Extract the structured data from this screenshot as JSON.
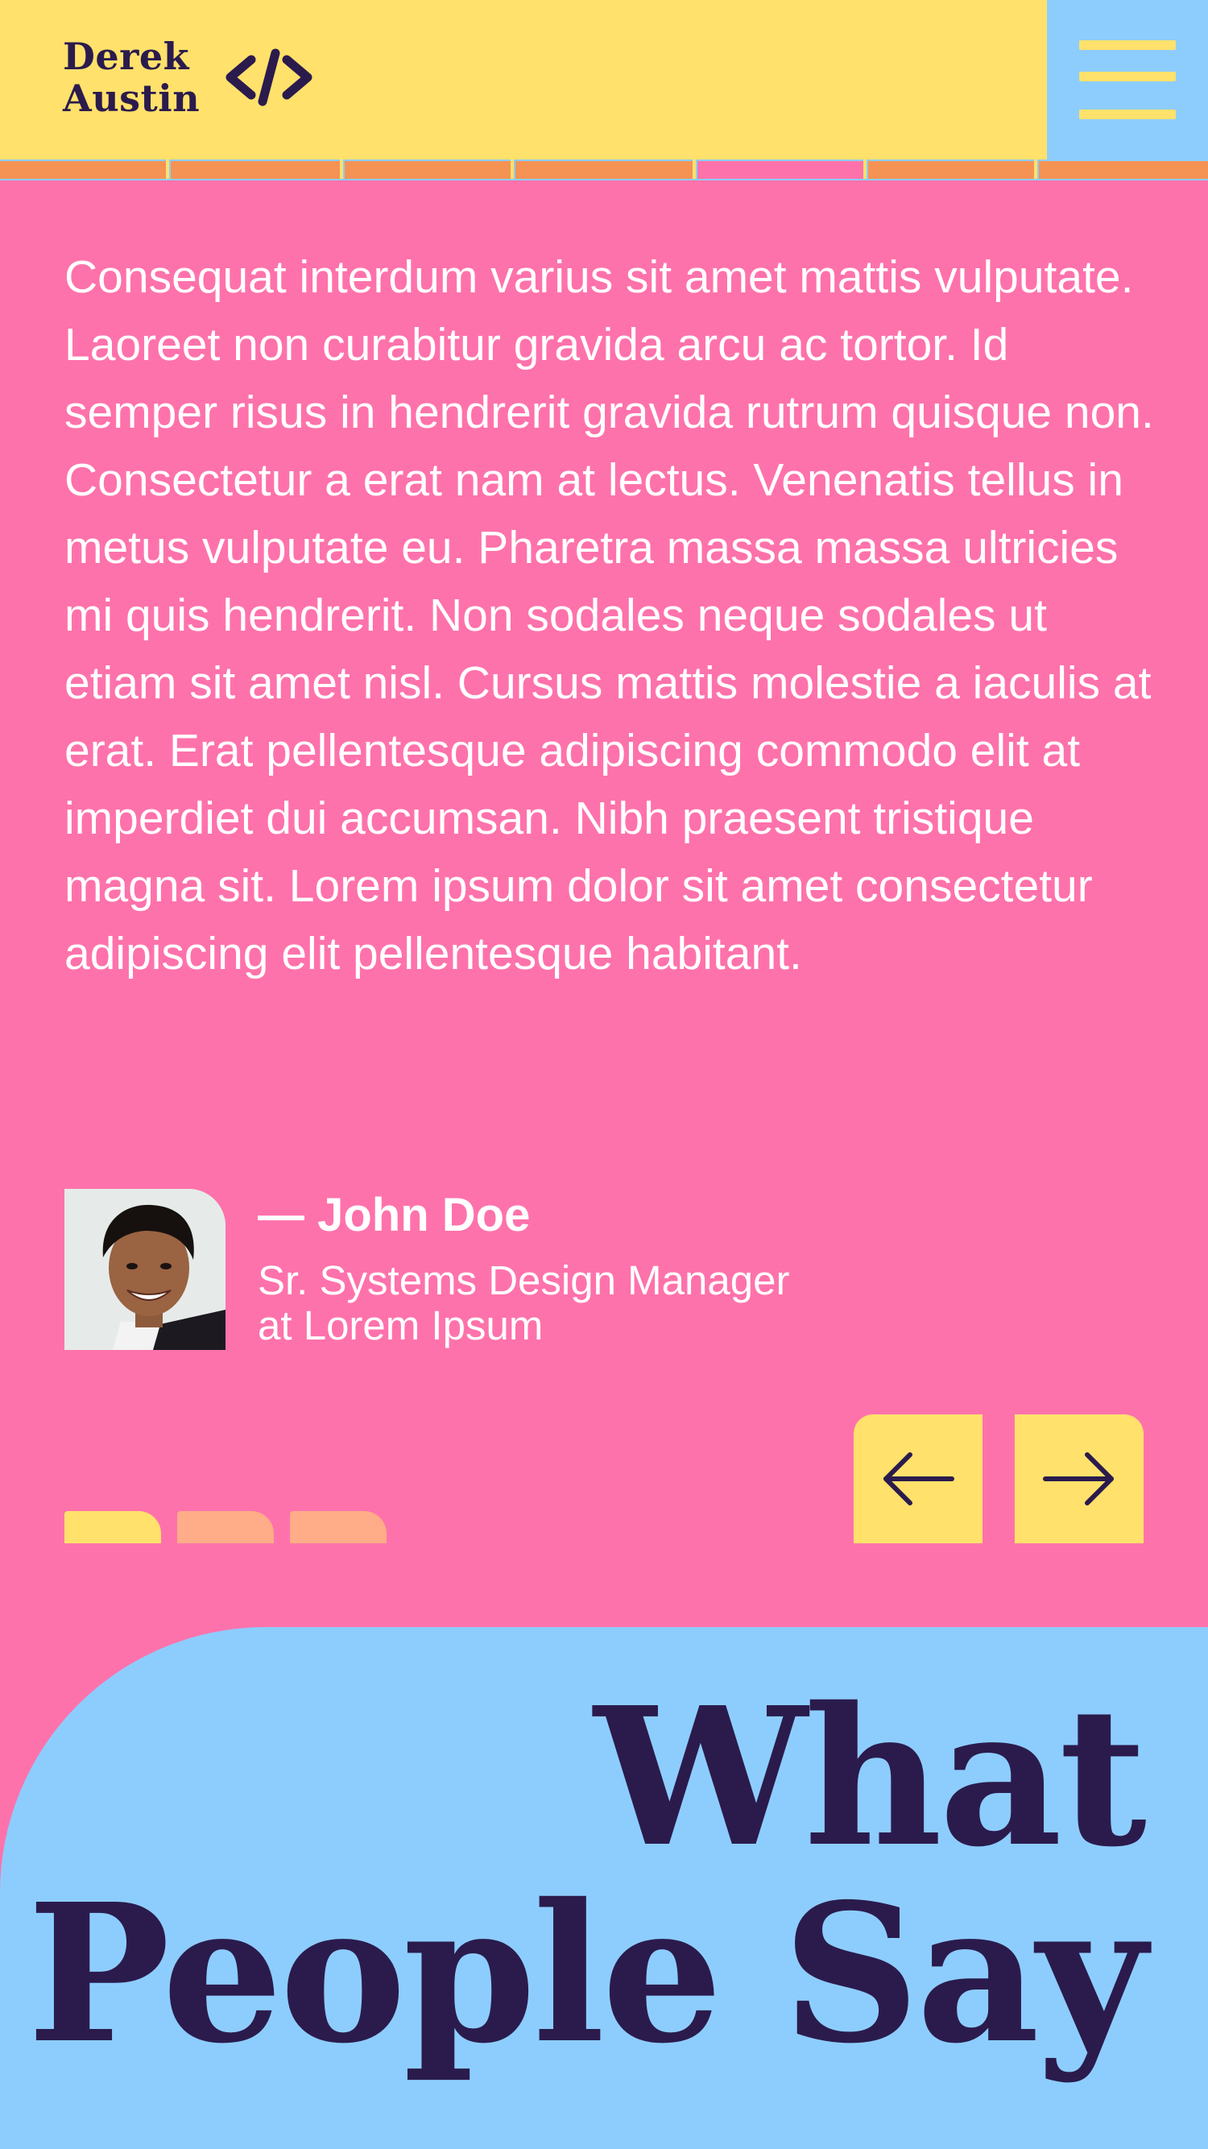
{
  "header": {
    "logo_line1": "Derek",
    "logo_line2": "Austin",
    "logo_icon": "code-brackets-icon",
    "menu_icon": "hamburger-menu-icon"
  },
  "colors": {
    "yellow": "#ffe16b",
    "pink": "#fe72ab",
    "blue": "#8dcdfd",
    "orange": "#f49354",
    "peach": "#ffac88",
    "navy": "#2b1b4d"
  },
  "tabs": {
    "count": 7,
    "active_index": 4
  },
  "testimonial": {
    "quote": "Consequat interdum varius sit amet mattis vulputate. Laoreet non curabitur gravida arcu ac tortor. Id semper risus in hendrerit gravida rutrum quisque non. Consectetur a erat nam at lectus. Venenatis tellus in metus vulputate eu. Pharetra massa massa ultricies mi quis hendrerit. Non sodales neque sodales ut etiam sit amet nisl. Cursus mattis molestie a iaculis at erat. Erat pellentesque adipiscing commodo elit at imperdiet dui accumsan. Nibh praesent tristique magna sit. Lorem ipsum dolor sit amet consectetur adipiscing elit pellentesque habitant.",
    "author": "— John Doe",
    "role_line1": "Sr. Systems Design Manager",
    "role_line2": "at Lorem Ipsum"
  },
  "slider": {
    "count": 3,
    "active_index": 0,
    "prev_icon": "arrow-left-icon",
    "next_icon": "arrow-right-icon"
  },
  "section": {
    "title_line1": "What",
    "title_line2": "People Say"
  }
}
